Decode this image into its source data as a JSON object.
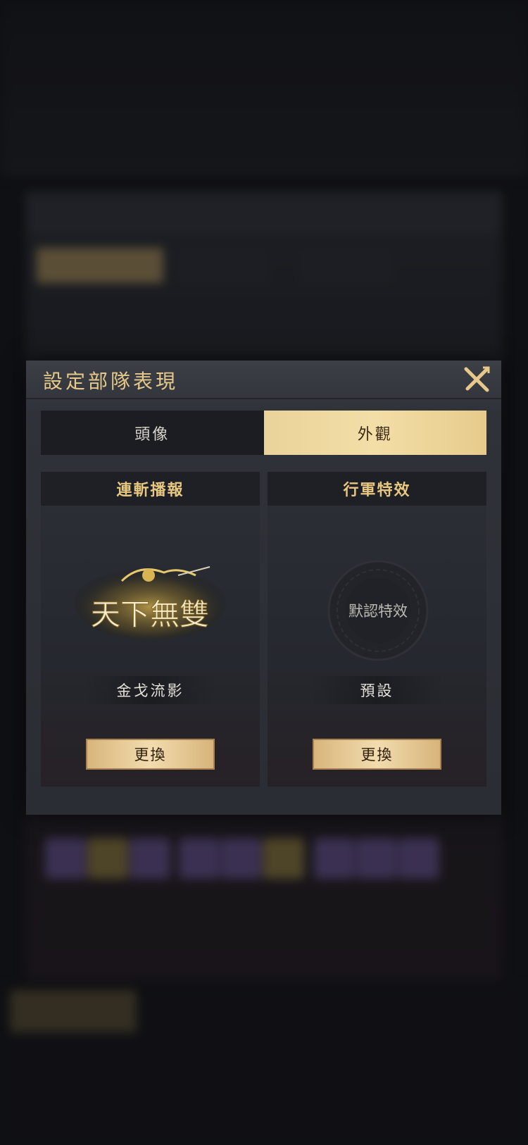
{
  "modal": {
    "title": "設定部隊表現",
    "tabs": [
      {
        "label": "頭像",
        "active": false
      },
      {
        "label": "外觀",
        "active": true
      }
    ],
    "cards": [
      {
        "header": "連斬播報",
        "preview_logo": "天下無雙",
        "name": "金戈流影",
        "button": "更換"
      },
      {
        "header": "行軍特效",
        "preview_logo": "默認特效",
        "name": "預設",
        "button": "更換"
      }
    ]
  },
  "colors": {
    "gold_text": "#e8c780",
    "active_tab": "#f3dea7",
    "panel": "#2a2d33"
  },
  "icons": {
    "close": "close-icon"
  }
}
